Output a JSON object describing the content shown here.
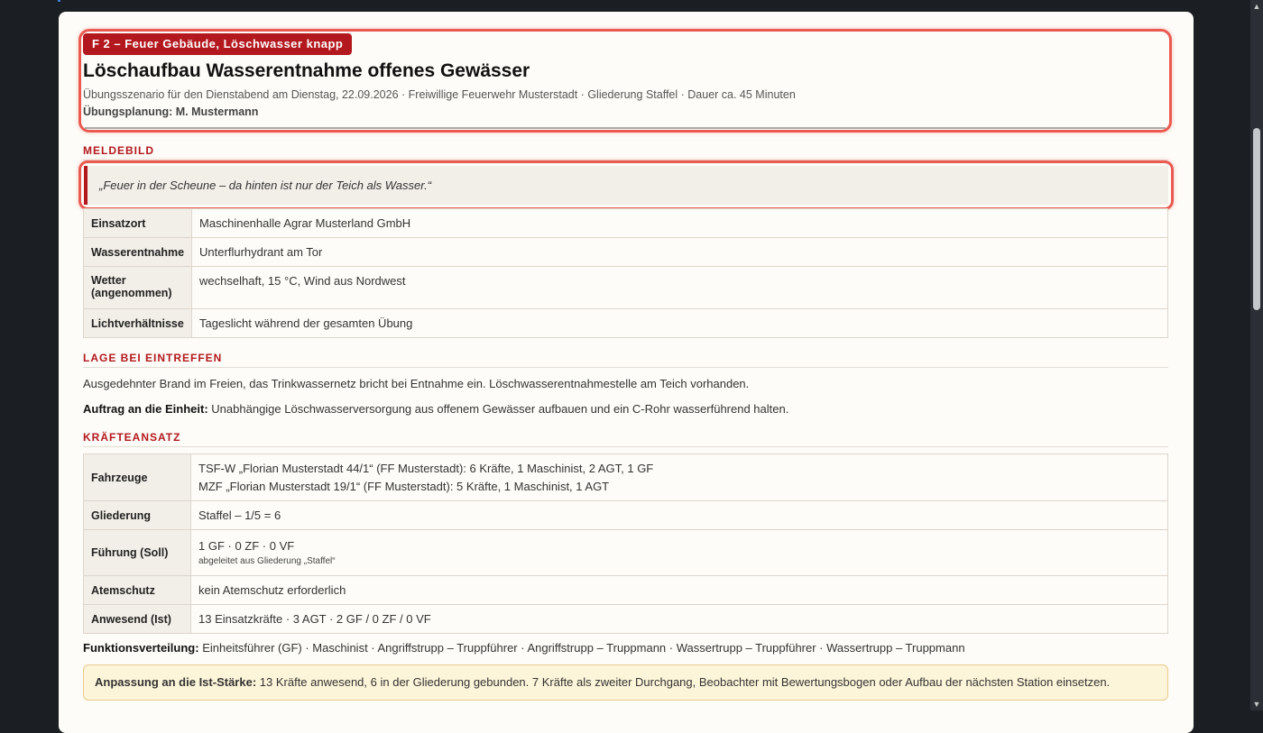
{
  "header": {
    "badge": "F 2 – Feuer Gebäude, Löschwasser knapp",
    "title": "Löschaufbau Wasserentnahme offenes Gewässer",
    "subtitle": "Übungsszenario für den Dienstabend am Dienstag, 22.09.2026 · Freiwillige Feuerwehr Musterstadt · Gliederung Staffel · Dauer ca. 45 Minuten",
    "planner": "Übungsplanung: M. Mustermann"
  },
  "meldebild": {
    "heading": "MELDEBILD",
    "quote": "„Feuer in der Scheune – da hinten ist nur der Teich als Wasser.“",
    "rows": [
      {
        "key": "Einsatzort",
        "value": "Maschinenhalle Agrar Musterland GmbH"
      },
      {
        "key": "Wasserentnahme",
        "value": "Unterflurhydrant am Tor"
      },
      {
        "key": "Wetter (angenommen)",
        "value": "wechselhaft, 15 °C, Wind aus Nordwest"
      },
      {
        "key": "Lichtverhältnisse",
        "value": "Tageslicht während der gesamten Übung"
      }
    ]
  },
  "lage": {
    "heading": "LAGE BEI EINTREFFEN",
    "text": "Ausgedehnter Brand im Freien, das Trinkwassernetz bricht bei Entnahme ein. Löschwasserentnahmestelle am Teich vorhanden.",
    "auftrag_label": "Auftrag an die Einheit:",
    "auftrag_text": "Unabhängige Löschwasserversorgung aus offenem Gewässer aufbauen und ein C-Rohr wasserführend halten."
  },
  "kraefte": {
    "heading": "KRÄFTEANSATZ",
    "fahrzeuge_key": "Fahrzeuge",
    "fahrzeuge_1": "TSF-W „Florian Musterstadt 44/1“ (FF Musterstadt): 6 Kräfte, 1 Maschinist, 2 AGT, 1 GF",
    "fahrzeuge_2": "MZF „Florian Musterstadt 19/1“ (FF Musterstadt): 5 Kräfte, 1 Maschinist, 1 AGT",
    "gliederung_key": "Gliederung",
    "gliederung_value": "Staffel – 1/5 = 6",
    "fuehrung_key": "Führung (Soll)",
    "fuehrung_value": "1 GF · 0 ZF · 0 VF",
    "fuehrung_note": "abgeleitet aus Gliederung „Staffel“",
    "atemschutz_key": "Atemschutz",
    "atemschutz_value": "kein Atemschutz erforderlich",
    "anwesend_key": "Anwesend (Ist)",
    "anwesend_value": "13 Einsatzkräfte · 3 AGT · 2 GF / 0 ZF / 0 VF",
    "funktion_label": "Funktionsverteilung:",
    "funktion_text": "Einheitsführer (GF) · Maschinist · Angriffstrupp – Truppführer · Angriffstrupp – Truppmann · Wassertrupp – Truppführer · Wassertrupp – Truppmann",
    "anpassung_label": "Anpassung an die Ist-Stärke:",
    "anpassung_text": "13 Kräfte anwesend, 6 in der Gliederung gebunden. 7 Kräfte als zweiter Durchgang, Beobachter mit Bewertungsbogen oder Aufbau der nächsten Station einsetzen."
  },
  "colors": {
    "accent": "#b3181e",
    "highlight": "#ea5a51",
    "notice_bg": "#fdf5d9"
  }
}
